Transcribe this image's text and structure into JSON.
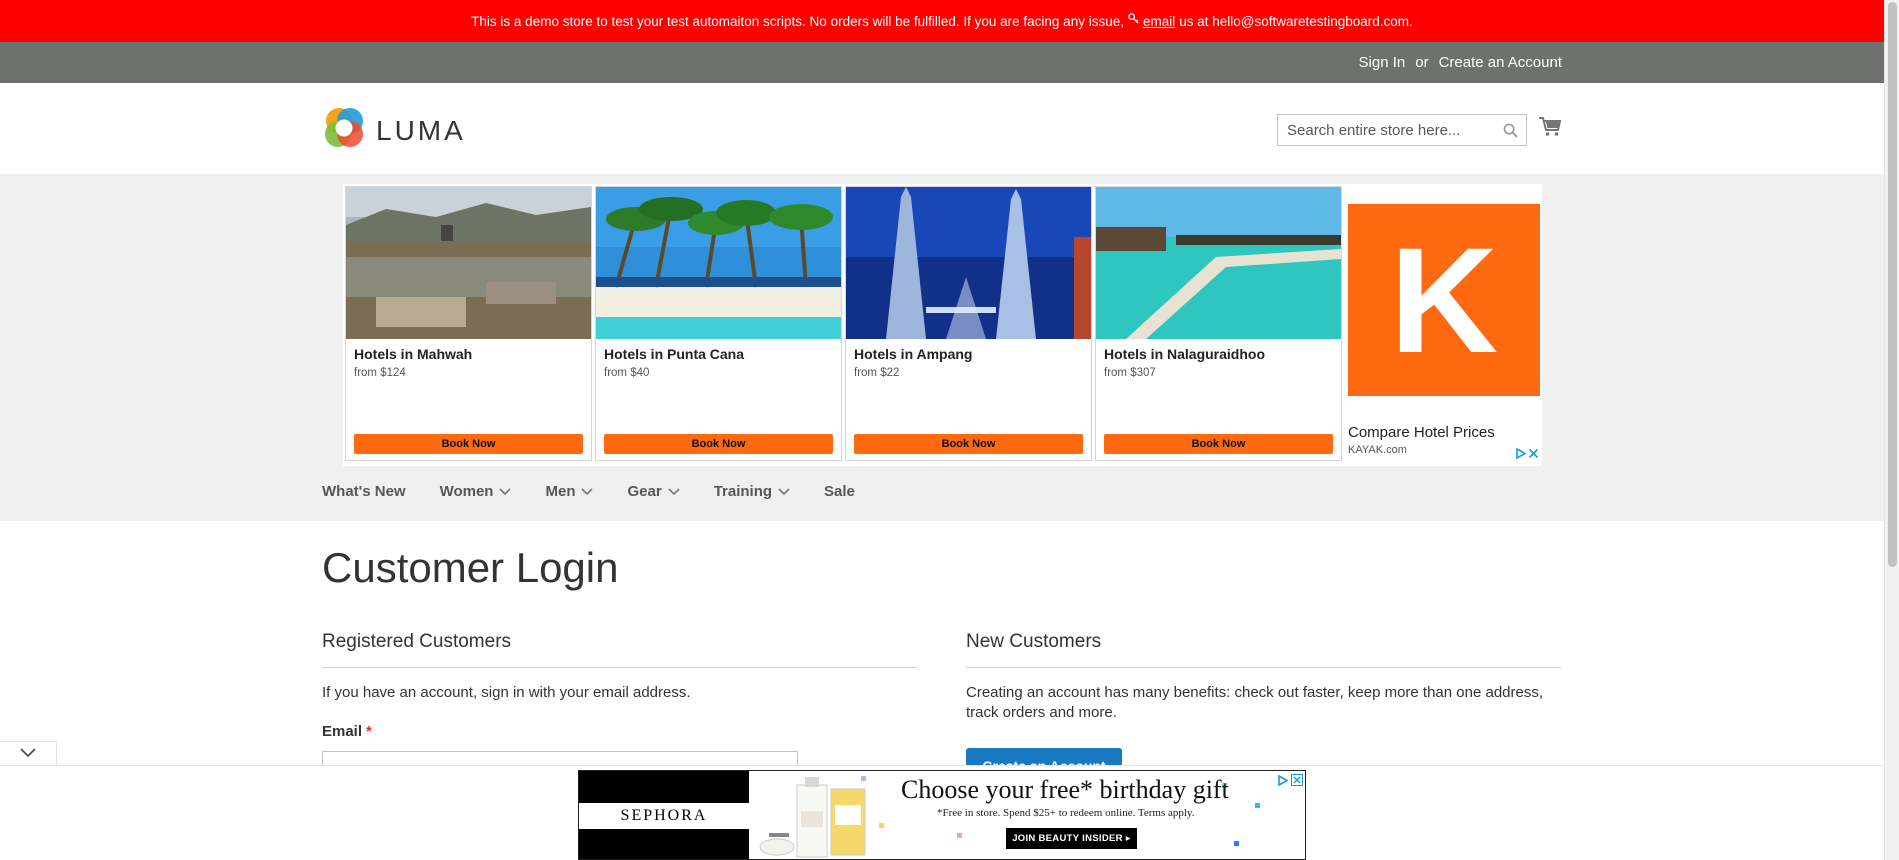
{
  "notice": {
    "text_before": "This is a demo store to test your test automaiton scripts. No orders will be fulfilled. If you are facing any issue,",
    "link": "email",
    "text_after": "us at hello@softwaretestingboard.com."
  },
  "header_links": {
    "sign_in": "Sign In",
    "or": "or",
    "create_account": "Create an Account"
  },
  "logo": {
    "text": "LUMA"
  },
  "search": {
    "placeholder": "Search entire store here..."
  },
  "ad": {
    "hotels": [
      {
        "name": "Hotels in Mahwah",
        "price": "from $124",
        "button": "Book Now"
      },
      {
        "name": "Hotels in Punta Cana",
        "price": "from $40",
        "button": "Book Now"
      },
      {
        "name": "Hotels in Ampang",
        "price": "from $22",
        "button": "Book Now"
      },
      {
        "name": "Hotels in Nalaguraidhoo",
        "price": "from $307",
        "button": "Book Now"
      }
    ],
    "kayak_letter": "K",
    "kayak_title": "Compare Hotel Prices",
    "kayak_domain": "KAYAK.com"
  },
  "nav": {
    "items": [
      {
        "label": "What's New"
      },
      {
        "label": "Women"
      },
      {
        "label": "Men"
      },
      {
        "label": "Gear"
      },
      {
        "label": "Training"
      },
      {
        "label": "Sale"
      }
    ]
  },
  "page": {
    "title": "Customer Login"
  },
  "registered": {
    "title": "Registered Customers",
    "intro": "If you have an account, sign in with your email address.",
    "email_label": "Email",
    "required_mark": "*"
  },
  "new_customers": {
    "title": "New Customers",
    "text": "Creating an account has many benefits: check out faster, keep more than one address, track orders and more.",
    "button": "Create an Account"
  },
  "bottom_ad": {
    "brand": "SEPHORA",
    "headline": "Choose your free* birthday gift",
    "fine_print": "*Free in store. Spend $25+ to redeem online. Terms apply.",
    "button": "JOIN BEAUTY INSIDER ▸"
  },
  "colors": {
    "notice_bg": "#ff0000",
    "panel_bg": "#6e716e",
    "accent_blue": "#1979c3",
    "kayak_orange": "#ff690f"
  }
}
